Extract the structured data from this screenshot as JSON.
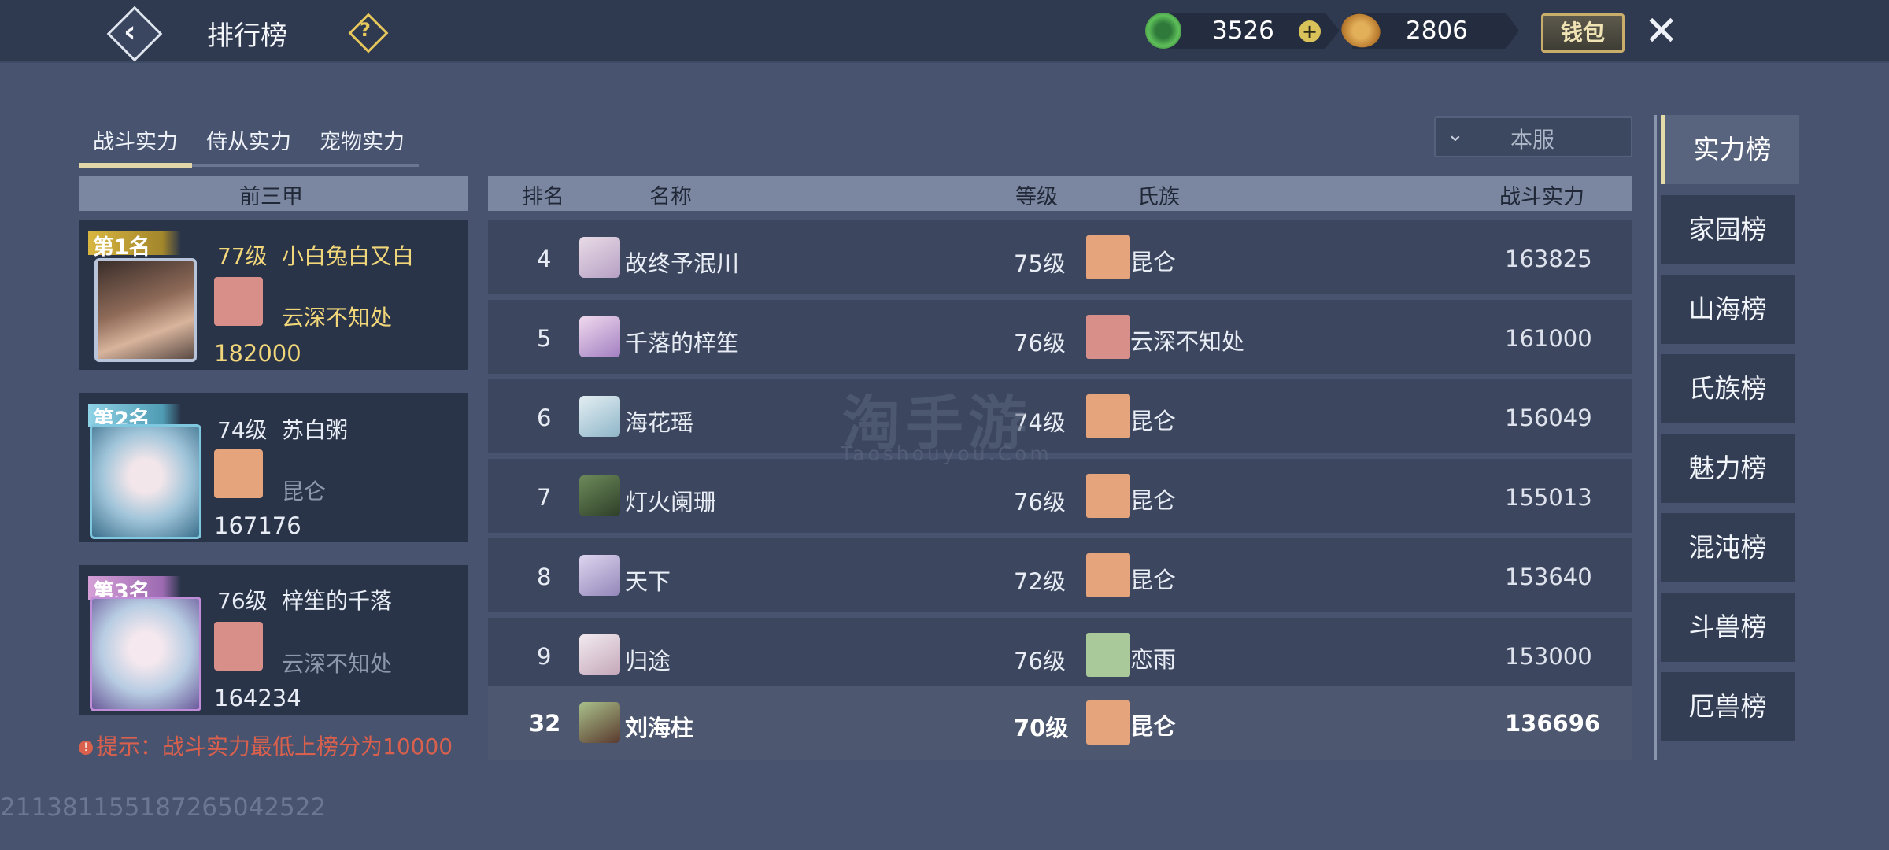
{
  "header": {
    "title": "排行榜",
    "jade_amount": "3526",
    "coin_amount": "2806",
    "wallet_label": "钱包",
    "icons": {
      "back": "back-chevron-icon",
      "help": "question-icon",
      "jade": "jade-coin-icon",
      "add": "plus-icon",
      "coin": "gold-coin-icon",
      "close": "close-x-icon"
    }
  },
  "tabs": [
    {
      "label": "战斗实力",
      "active": true
    },
    {
      "label": "侍从实力",
      "active": false
    },
    {
      "label": "宠物实力",
      "active": false
    }
  ],
  "server_filter": {
    "value": "本服"
  },
  "top3": {
    "header": "前三甲",
    "cards": [
      {
        "rank_label": "第1名",
        "level": "77级",
        "name": "小白兔白又白",
        "clan": "云深不知处",
        "power": "182000"
      },
      {
        "rank_label": "第2名",
        "level": "74级",
        "name": "苏白粥",
        "clan": "昆仑",
        "power": "167176"
      },
      {
        "rank_label": "第3名",
        "level": "76级",
        "name": "梓笙的千落",
        "clan": "云深不知处",
        "power": "164234"
      }
    ]
  },
  "table": {
    "columns": {
      "rank": "排名",
      "name": "名称",
      "level": "等级",
      "clan": "氏族",
      "power": "战斗实力"
    },
    "rows": [
      {
        "rank": "4",
        "name": "故终予泯川",
        "level": "75级",
        "clan": "昆仑",
        "power": "163825"
      },
      {
        "rank": "5",
        "name": "千落的梓笙",
        "level": "76级",
        "clan": "云深不知处",
        "power": "161000"
      },
      {
        "rank": "6",
        "name": "海花瑶",
        "level": "74级",
        "clan": "昆仑",
        "power": "156049"
      },
      {
        "rank": "7",
        "name": "灯火阑珊",
        "level": "76级",
        "clan": "昆仑",
        "power": "155013"
      },
      {
        "rank": "8",
        "name": "天下",
        "level": "72级",
        "clan": "昆仑",
        "power": "153640"
      },
      {
        "rank": "9",
        "name": "归途",
        "level": "76级",
        "clan": "恋雨",
        "power": "153000"
      },
      {
        "rank": "32",
        "name": "刘海柱",
        "level": "70级",
        "clan": "昆仑",
        "power": "136696"
      }
    ]
  },
  "sidebar": {
    "items": [
      "实力榜",
      "家园榜",
      "山海榜",
      "氏族榜",
      "魅力榜",
      "混沌榜",
      "斗兽榜",
      "厄兽榜"
    ],
    "active_index": 0
  },
  "hint": "提示：战斗实力最低上榜分为10000",
  "uid": "2113811551872650425​22",
  "watermark": {
    "main": "淘手游",
    "sub": "Taoshouyou.Com"
  },
  "colors": {
    "gold_text": "#f2d77a",
    "hint_red": "#d9604d",
    "clan_kunlun": "#e6a47c",
    "clan_yunshen": "#d88f8a",
    "clan_lianyu": "#a9c99a"
  }
}
